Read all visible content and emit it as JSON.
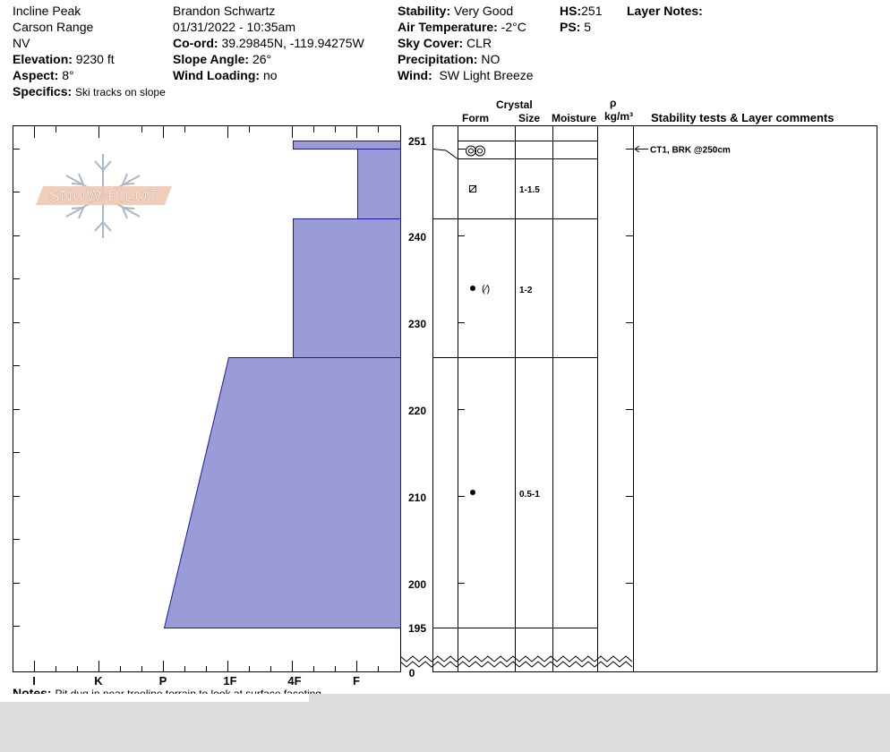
{
  "header": {
    "location": "Incline Peak",
    "range": "Carson Range",
    "state": "NV",
    "elevation_label": "Elevation:",
    "elevation_value": "9230 ft",
    "aspect_label": "Aspect:",
    "aspect_value": "8°",
    "specifics_label": "Specifics:",
    "specifics_value": "Ski tracks on slope",
    "observer": "Brandon Schwartz",
    "datetime": "01/31/2022 - 10:35am",
    "coord_label": "Co-ord:",
    "coord_value": "39.29845N, -119.94275W",
    "slope_label": "Slope Angle:",
    "slope_value": "26°",
    "wind_loading_label": "Wind Loading:",
    "wind_loading_value": "no",
    "stability_label": "Stability:",
    "stability_value": "Very Good",
    "air_temp_label": "Air Temperature:",
    "air_temp_value": "-2°C",
    "sky_label": "Sky Cover:",
    "sky_value": "CLR",
    "precip_label": "Precipitation:",
    "precip_value": "NO",
    "wind_label": "Wind:",
    "wind_value": "SW Light Breeze",
    "hs_label": "HS:",
    "hs_value": "251",
    "ps_label": "PS:",
    "ps_value": "5",
    "layer_notes_label": "Layer Notes:"
  },
  "logo": {
    "text": "SNOW PILOT"
  },
  "columns": {
    "crystal": "Crystal",
    "form": "Form",
    "size": "Size",
    "moisture": "Moisture",
    "rho": "ρ",
    "density_unit": "kg/m³",
    "comments": "Stability tests & Layer comments"
  },
  "hardness_axis": {
    "labels": [
      "I",
      "K",
      "P",
      "1F",
      "4F",
      "F"
    ]
  },
  "height_axis": {
    "labels": [
      "251",
      "240",
      "230",
      "220",
      "210",
      "200",
      "195",
      "0"
    ]
  },
  "chart_data": {
    "type": "snow-profile",
    "hs_cm": 251,
    "profile_bottom_cm": 195,
    "hardness_scale": [
      "F",
      "4F",
      "1F",
      "P",
      "K",
      "I"
    ],
    "layers": [
      {
        "top_cm": 251,
        "bottom_cm": 250,
        "hardness": "4F",
        "form": "melt-forms",
        "size": ""
      },
      {
        "top_cm": 250,
        "bottom_cm": 242,
        "hardness": "F",
        "form": "faceted",
        "size": "1-1.5"
      },
      {
        "top_cm": 242,
        "bottom_cm": 226,
        "hardness": "4F",
        "form": "rounds with facets",
        "size": "1-2"
      },
      {
        "top_cm": 226,
        "bottom_cm": 195,
        "hardness": "1F to P",
        "form": "rounds",
        "size": "0.5-1"
      }
    ]
  },
  "layers_table": {
    "sizes": [
      "1-1.5",
      "1-2",
      "0.5-1"
    ],
    "form_symbols": [
      "◎◎",
      "⧄",
      "● (⁄)",
      "●"
    ]
  },
  "comments": {
    "ct_result": "CT1, BRK @250cm"
  },
  "notes": {
    "label": "Notes:",
    "value": "Pit dug in near treeline terrain to look at surface faceting"
  }
}
